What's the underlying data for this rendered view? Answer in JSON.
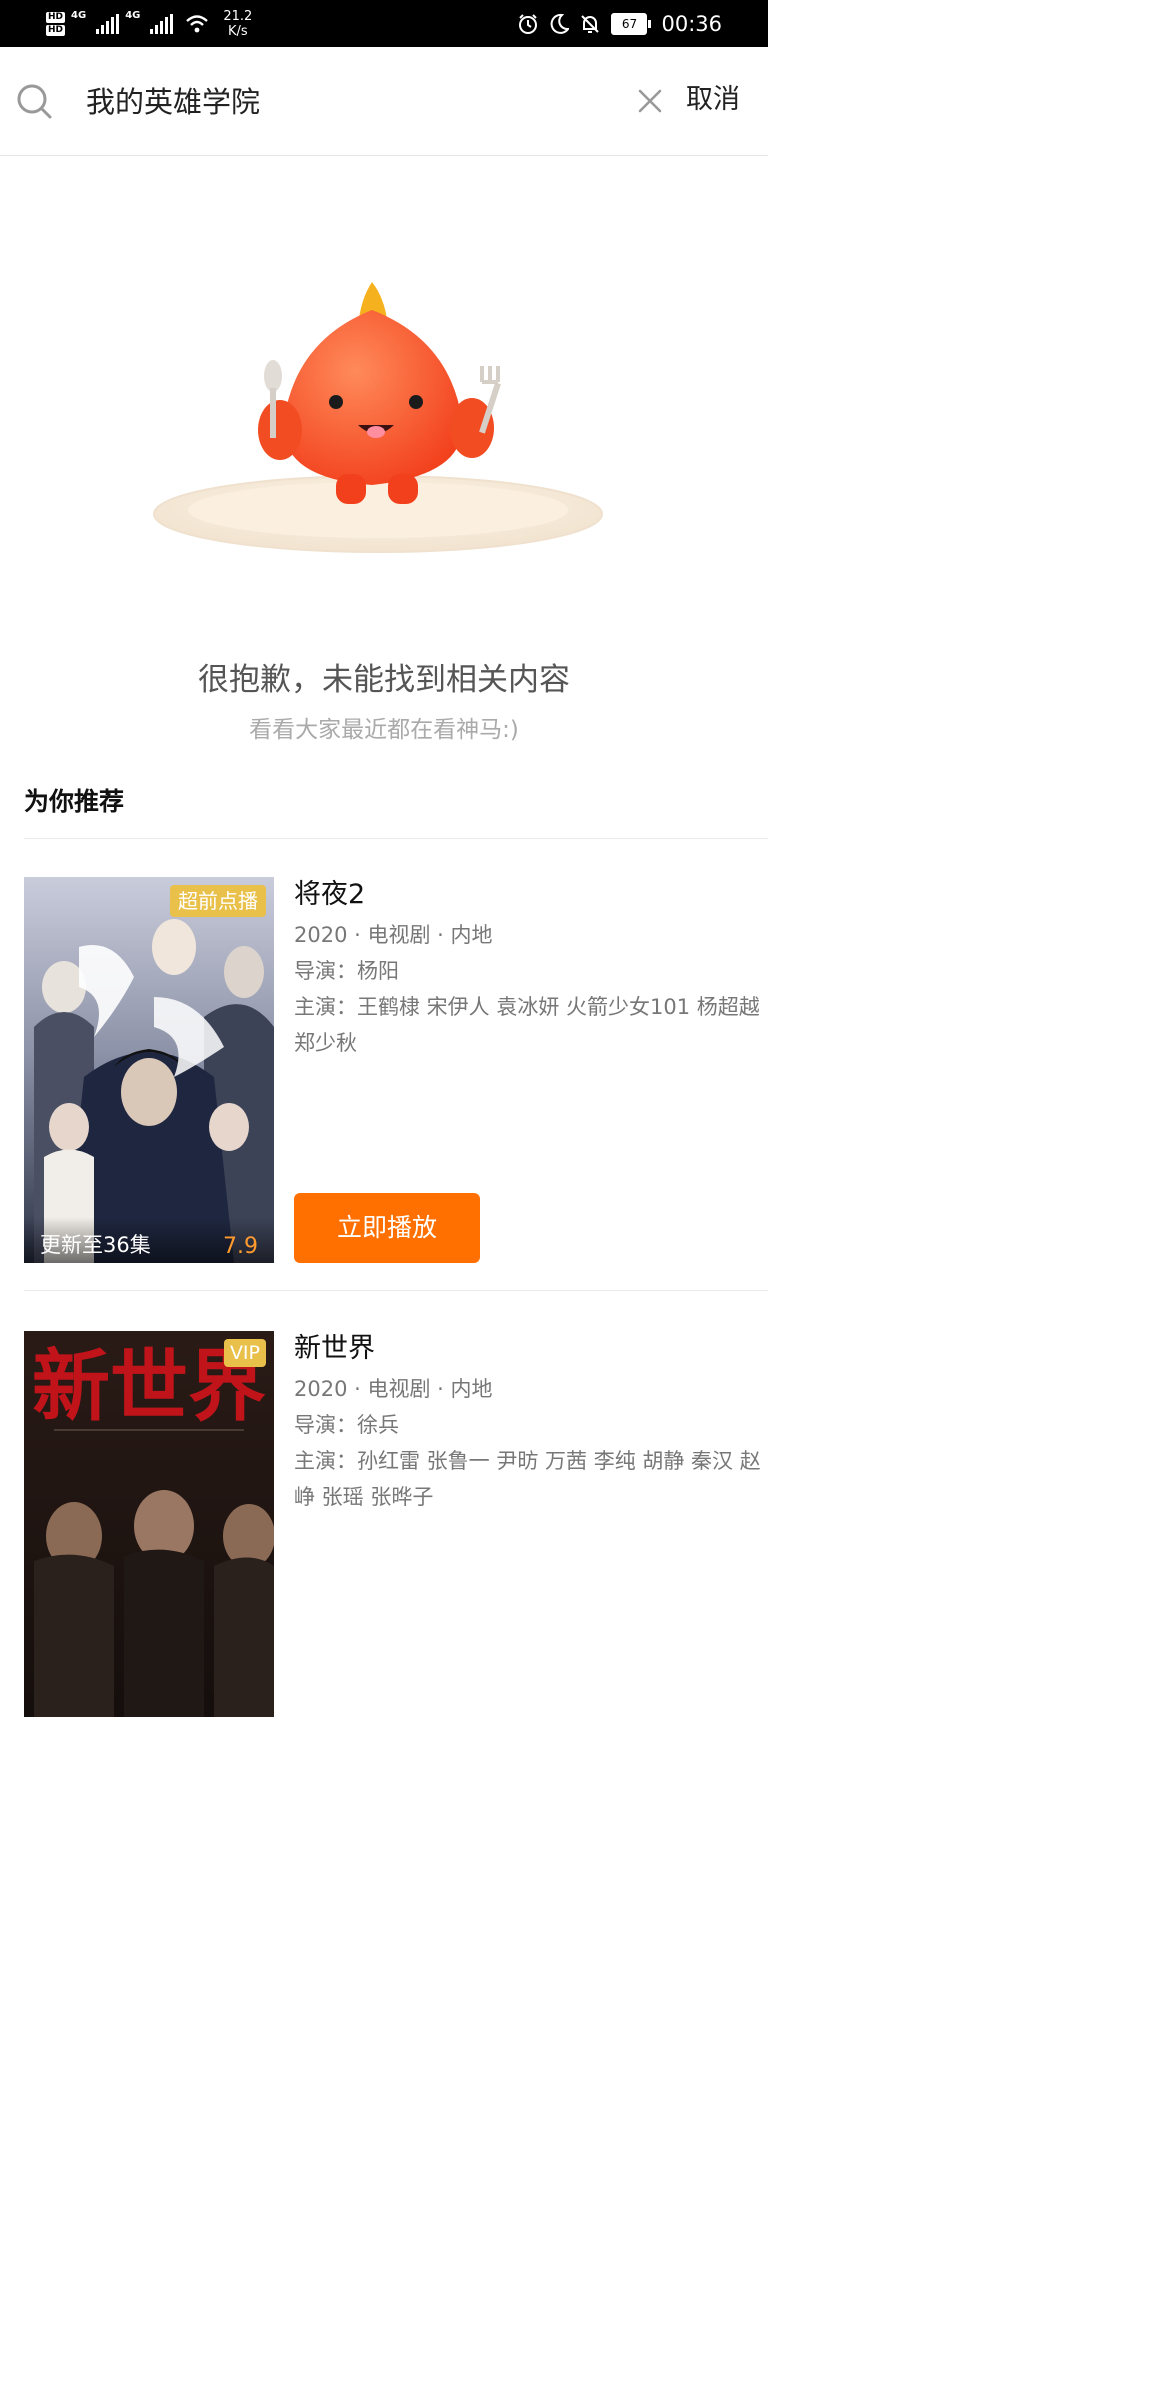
{
  "status_bar": {
    "hd1": "HD",
    "hd2": "HD",
    "net1": "4G",
    "net2": "4G",
    "speed_value": "21.2",
    "speed_unit": "K/s",
    "battery": "67",
    "time": "00:36"
  },
  "search": {
    "query": "我的英雄学院",
    "cancel_label": "取消"
  },
  "empty_state": {
    "title": "很抱歉，未能找到相关内容",
    "subtitle": "看看大家最近都在看神马:)"
  },
  "recommend": {
    "section_title": "为你推荐",
    "items": [
      {
        "title": "将夜2",
        "badge": "超前点播",
        "meta": "2020 · 电视剧 · 内地",
        "director": "导演：杨阳",
        "cast": "主演：王鹤棣 宋伊人 袁冰妍 火箭少女101 杨超越 郑少秋",
        "update": "更新至36集",
        "score": "7.9",
        "play_label": "立即播放"
      },
      {
        "title": "新世界",
        "badge": "VIP",
        "meta": "2020 · 电视剧 · 内地",
        "director": "导演：徐兵",
        "cast": "主演：孙红雷 张鲁一 尹昉 万茜 李纯 胡静 秦汉 赵峥 张瑶 张晔子",
        "poster_text": "新世界"
      }
    ]
  },
  "colors": {
    "accent": "#ff7000",
    "badge": "#e8c04a",
    "score": "#ff9a2e"
  }
}
